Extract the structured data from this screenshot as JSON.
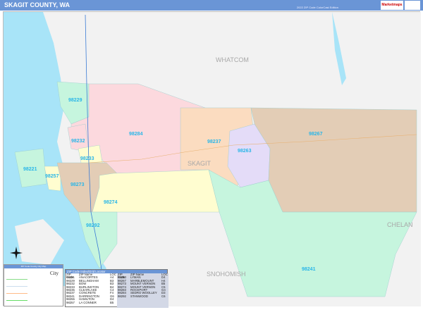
{
  "header": {
    "title": "SKAGIT COUNTY, WA",
    "edition": "2022 ZIP Code ColorCast Edition",
    "logo": "Marketmaps"
  },
  "counties": [
    "WHATCOM",
    "SKAGIT",
    "CHELAN",
    "SNOHOMISH"
  ],
  "zip_labels": [
    "98229",
    "98284",
    "98232",
    "98233",
    "98237",
    "98263",
    "98267",
    "98221",
    "98257",
    "98273",
    "98274",
    "98292",
    "98241"
  ],
  "colors": {
    "water": "#a8e4f8",
    "land": "#f2f2f2",
    "pink": "#fcd9de",
    "green": "#c6f5de",
    "yellow": "#fffdd0",
    "tan": "#e3cdb6",
    "orange": "#fbdcc0",
    "lavender": "#e4dcf8",
    "header": "#6a95d6"
  },
  "legend": {
    "title": "ZIP Code County City Map",
    "city_label": "City"
  },
  "zip_table": {
    "title": "ZIP Code Index/Grid Locator",
    "headers": [
      "ZIP Code",
      "ZIP Name",
      "LOC"
    ],
    "left": [
      [
        "98221",
        "ANACORTES",
        "A4"
      ],
      [
        "98229",
        "BELLINGHAM",
        "B3"
      ],
      [
        "98232",
        "BOW",
        "B3"
      ],
      [
        "98233",
        "BURLINGTON",
        "B4"
      ],
      [
        "98235",
        "CLEARLAKE",
        "C4"
      ],
      [
        "98237",
        "CONCRETE",
        "F4"
      ],
      [
        "98241",
        "DARRINGTON",
        "G6"
      ],
      [
        "98255",
        "HAMILTON",
        "D4"
      ],
      [
        "98257",
        "LA CONNER",
        "B5"
      ]
    ],
    "right": [
      [
        "98263",
        "LYMAN",
        "D4"
      ],
      [
        "98267",
        "MARBLEMOUNT",
        "H4"
      ],
      [
        "98273",
        "MOUNT VERNON",
        "B5"
      ],
      [
        "98274",
        "MOUNT VERNON",
        "C5"
      ],
      [
        "98283",
        "ROCKPORT",
        "G4"
      ],
      [
        "98284",
        "SEDRO WOOLLEY",
        "D3"
      ],
      [
        "98292",
        "STANWOOD",
        "C6"
      ]
    ]
  }
}
